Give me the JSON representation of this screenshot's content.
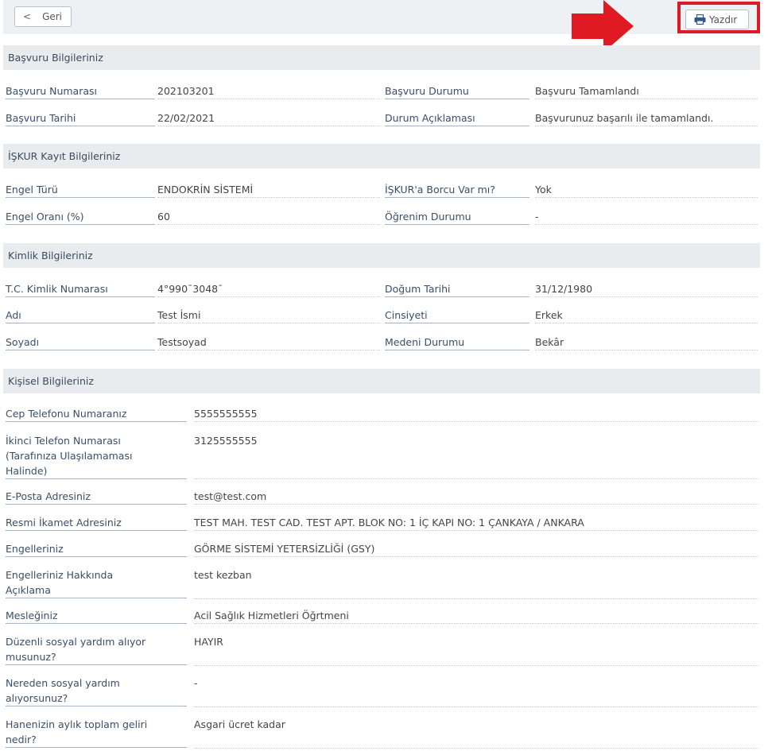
{
  "toolbar": {
    "back_label": "Geri",
    "print_label": "Yazdır"
  },
  "colors": {
    "accent_red": "#e01a22",
    "header_bg": "#e9ecef",
    "link": "#1e73be"
  },
  "sections": {
    "basvuru": {
      "title": "Başvuru Bilgileriniz",
      "rows": [
        {
          "l1": "Başvuru Numarası",
          "v1": "202103201",
          "l2": "Başvuru Durumu",
          "v2": "Başvuru Tamamlandı"
        },
        {
          "l1": "Başvuru Tarihi",
          "v1": "22/02/2021",
          "l2": "Durum Açıklaması",
          "v2": "Başvurunuz başarılı ile tamamlandı."
        }
      ]
    },
    "iskur": {
      "title": "İŞKUR Kayıt Bilgileriniz",
      "rows": [
        {
          "l1": "Engel Türü",
          "v1": "ENDOKRİN SİSTEMİ",
          "l2": "İŞKUR'a Borcu Var mı?",
          "v2": "Yok"
        },
        {
          "l1": "Engel Oranı (%)",
          "v1": "60",
          "l2": "Öğrenim Durumu",
          "v2": "-"
        }
      ]
    },
    "kimlik": {
      "title": "Kimlik Bilgileriniz",
      "rows": [
        {
          "l1": "T.C. Kimlik Numarası",
          "v1": "4°990¯3048¯",
          "l2": "Doğum Tarihi",
          "v2": "31/12/1980"
        },
        {
          "l1": "Adı",
          "v1": "Test İsmi",
          "l2": "Cinsiyeti",
          "v2": "Erkek"
        },
        {
          "l1": "Soyadı",
          "v1": "Testsoyad",
          "l2": "Medeni Durumu",
          "v2": "Bekâr"
        }
      ]
    },
    "kisisel": {
      "title": "Kişisel Bilgileriniz",
      "rows": [
        {
          "label": "Cep Telefonu Numaranız",
          "value": "5555555555"
        },
        {
          "label": "İkinci Telefon Numarası (Tarafınıza Ulaşılamaması Halinde)",
          "value": "3125555555"
        },
        {
          "label": "E-Posta Adresiniz",
          "value": "test@test.com"
        },
        {
          "label": "Resmi İkamet Adresiniz",
          "value": "TEST MAH. TEST CAD. TEST APT. BLOK NO: 1 İÇ KAPI NO: 1 ÇANKAYA / ANKARA"
        },
        {
          "label": "Engelleriniz",
          "value": "GÖRME SİSTEMİ YETERSİZLİĞİ (GSY)"
        },
        {
          "label": "Engelleriniz Hakkında Açıklama",
          "value": "test kezban"
        },
        {
          "label": "Mesleğiniz",
          "value": "Acil Sağlık Hizmetleri Öğrtmeni"
        },
        {
          "label": "Düzenli sosyal yardım alıyor musunuz?",
          "value": "HAYIR"
        },
        {
          "label": "Nereden sosyal yardım alıyorsunuz?",
          "value": "-"
        },
        {
          "label": "Hanenizin aylık toplam geliri nedir?",
          "value": "Asgari ücret kadar"
        }
      ]
    }
  }
}
